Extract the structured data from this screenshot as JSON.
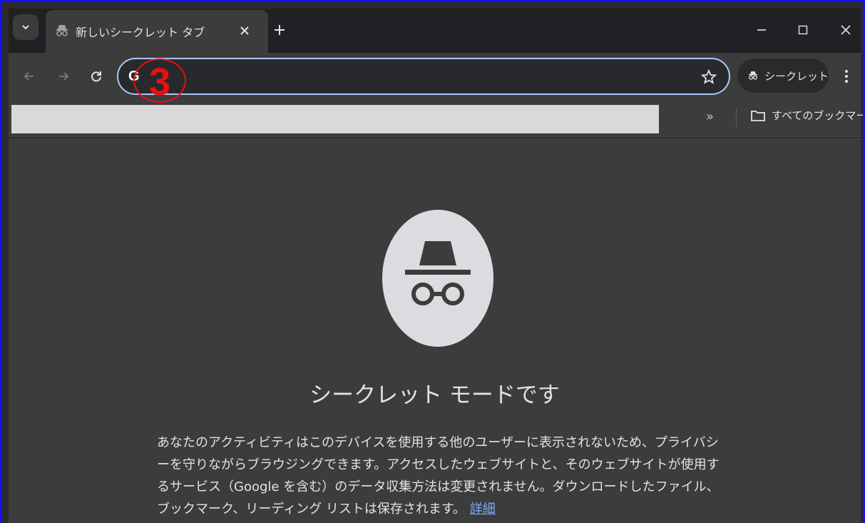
{
  "tab": {
    "title": "新しいシークレット タブ"
  },
  "toolbar": {
    "omnibox_text": "",
    "omnibox_g": "G",
    "badge_number": "3",
    "incognito_chip_label": "シークレット"
  },
  "bookmarks": {
    "overflow_label": "»",
    "all_bookmarks_label": "すべてのブックマーク"
  },
  "content": {
    "headline": "シークレット モードです",
    "description": "あなたのアクティビティはこのデバイスを使用する他のユーザーに表示されないため、プライバシーを守りながらブラウジングできます。アクセスしたウェブサイトと、そのウェブサイトが使用するサービス（Google を含む）のデータ収集方法は変更されません。ダウンロードしたファイル、ブックマーク、リーディング リストは保存されます。",
    "learn_more_link": "詳細"
  },
  "icons": {
    "tab_search": "chevron-down-icon",
    "tab_favicon": "incognito-icon",
    "close": "close-icon",
    "new_tab": "plus-icon",
    "minimize": "minimize-icon",
    "maximize": "maximize-icon",
    "window_close": "close-icon",
    "back": "arrow-left-icon",
    "forward": "arrow-right-icon",
    "reload": "reload-icon",
    "star": "star-icon",
    "menu": "kebab-menu-icon",
    "folder": "folder-icon"
  },
  "colors": {
    "accent_border": "#a8c7fa",
    "link": "#7cacf8",
    "badge": "#e81010",
    "frame_border": "#1a0ff0"
  }
}
